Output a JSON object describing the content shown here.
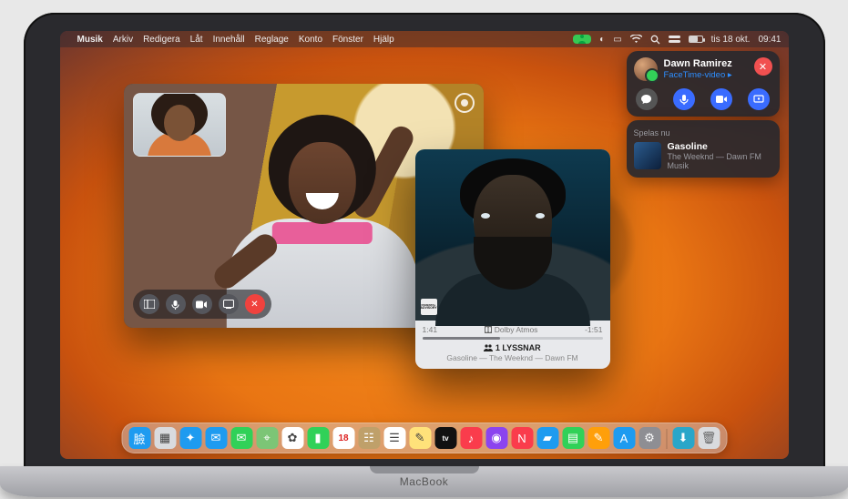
{
  "menubar": {
    "app": "Musik",
    "items": [
      "Arkiv",
      "Redigera",
      "Låt",
      "Innehåll",
      "Reglage",
      "Konto",
      "Fönster",
      "Hjälp"
    ],
    "date": "tis 18 okt.",
    "time": "09:41"
  },
  "notification": {
    "caller_name": "Dawn Ramirez",
    "caller_sub": "FaceTime-video ▸",
    "now_playing_header": "Spelas nu",
    "np_title": "Gasoline",
    "np_artist_album": "The Weeknd — Dawn FM",
    "np_app": "Musik"
  },
  "music_player": {
    "elapsed": "1:41",
    "remaining": "-1:51",
    "dolby": "Dolby Atmos",
    "listeners_label": "1 LYSSNAR",
    "track_line": "Gasoline — The Weeknd — Dawn FM",
    "advisory": "PARENTAL ADVISORY"
  },
  "dock": {
    "apps": [
      {
        "name": "finder",
        "bg": "#1e9bf0",
        "glyph": "臉"
      },
      {
        "name": "launchpad",
        "bg": "#d9dbde",
        "glyph": "▦"
      },
      {
        "name": "safari",
        "bg": "#1e9bf0",
        "glyph": "✦"
      },
      {
        "name": "mail",
        "bg": "#1e9bf0",
        "glyph": "✉"
      },
      {
        "name": "messages",
        "bg": "#30d158",
        "glyph": "✉"
      },
      {
        "name": "maps",
        "bg": "#7cc576",
        "glyph": "⌖"
      },
      {
        "name": "photos",
        "bg": "#ffffff",
        "glyph": "✿"
      },
      {
        "name": "facetime",
        "bg": "#30d158",
        "glyph": "▮"
      },
      {
        "name": "calendar",
        "bg": "#ffffff",
        "glyph": "18"
      },
      {
        "name": "contacts",
        "bg": "#bfa06a",
        "glyph": "☷"
      },
      {
        "name": "reminders",
        "bg": "#ffffff",
        "glyph": "☰"
      },
      {
        "name": "notes",
        "bg": "#ffe27a",
        "glyph": "✎"
      },
      {
        "name": "tv",
        "bg": "#111",
        "glyph": "tv"
      },
      {
        "name": "music",
        "bg": "#fa3c4c",
        "glyph": "♪"
      },
      {
        "name": "podcasts",
        "bg": "#8b44ef",
        "glyph": "◉"
      },
      {
        "name": "news",
        "bg": "#fa3c4c",
        "glyph": "N"
      },
      {
        "name": "keynote",
        "bg": "#1e9bf0",
        "glyph": "▰"
      },
      {
        "name": "numbers",
        "bg": "#30d158",
        "glyph": "▤"
      },
      {
        "name": "pages",
        "bg": "#ff9f0a",
        "glyph": "✎"
      },
      {
        "name": "appstore",
        "bg": "#1e9bf0",
        "glyph": "A"
      },
      {
        "name": "settings",
        "bg": "#8e8e93",
        "glyph": "⚙"
      }
    ],
    "right": [
      {
        "name": "downloads",
        "bg": "#2aa6c9",
        "glyph": "⬇"
      },
      {
        "name": "trash",
        "bg": "#d9dbde",
        "glyph": "🗑"
      }
    ]
  },
  "laptop_label": "MacBook"
}
